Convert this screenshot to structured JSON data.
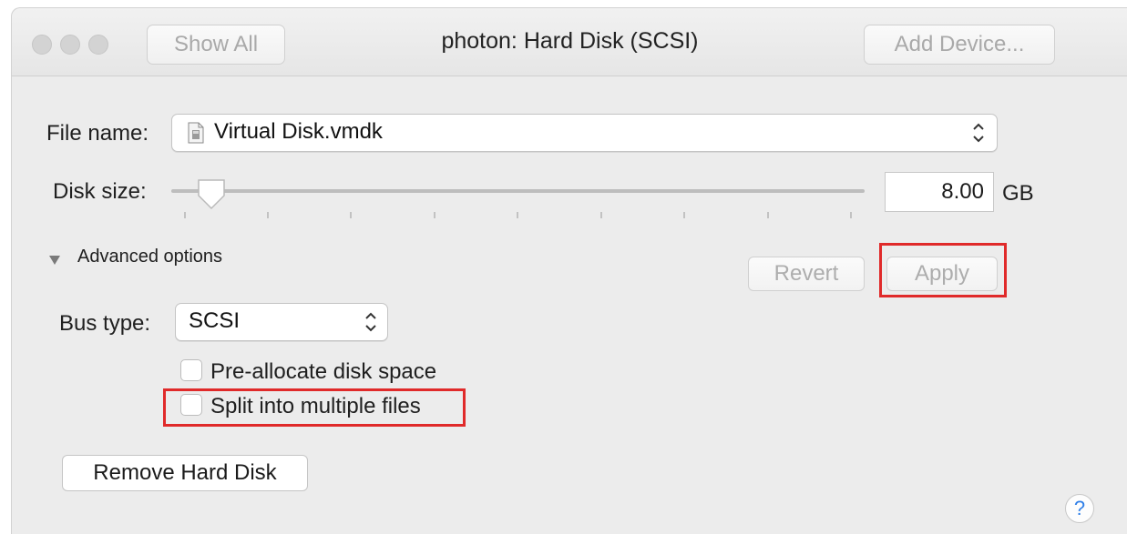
{
  "window": {
    "title": "photon: Hard Disk (SCSI)",
    "show_all_label": "Show All",
    "add_device_label": "Add Device..."
  },
  "file": {
    "label": "File name:",
    "value": "Virtual Disk.vmdk",
    "icon": "disk-file-icon"
  },
  "disk": {
    "label": "Disk size:",
    "size_value": "8.00",
    "unit": "GB",
    "slider_level": 0.05
  },
  "advanced": {
    "label": "Advanced options",
    "expanded": true
  },
  "actions": {
    "revert_label": "Revert",
    "apply_label": "Apply"
  },
  "bus": {
    "label": "Bus type:",
    "value": "SCSI"
  },
  "options": {
    "preallocate_label": "Pre-allocate disk space",
    "split_label": "Split into multiple files"
  },
  "remove_label": "Remove Hard Disk",
  "help_label": "?",
  "colors": {
    "highlight": "#e02a2a",
    "help_blue": "#2f7fe8",
    "window_bg": "#ececec"
  }
}
